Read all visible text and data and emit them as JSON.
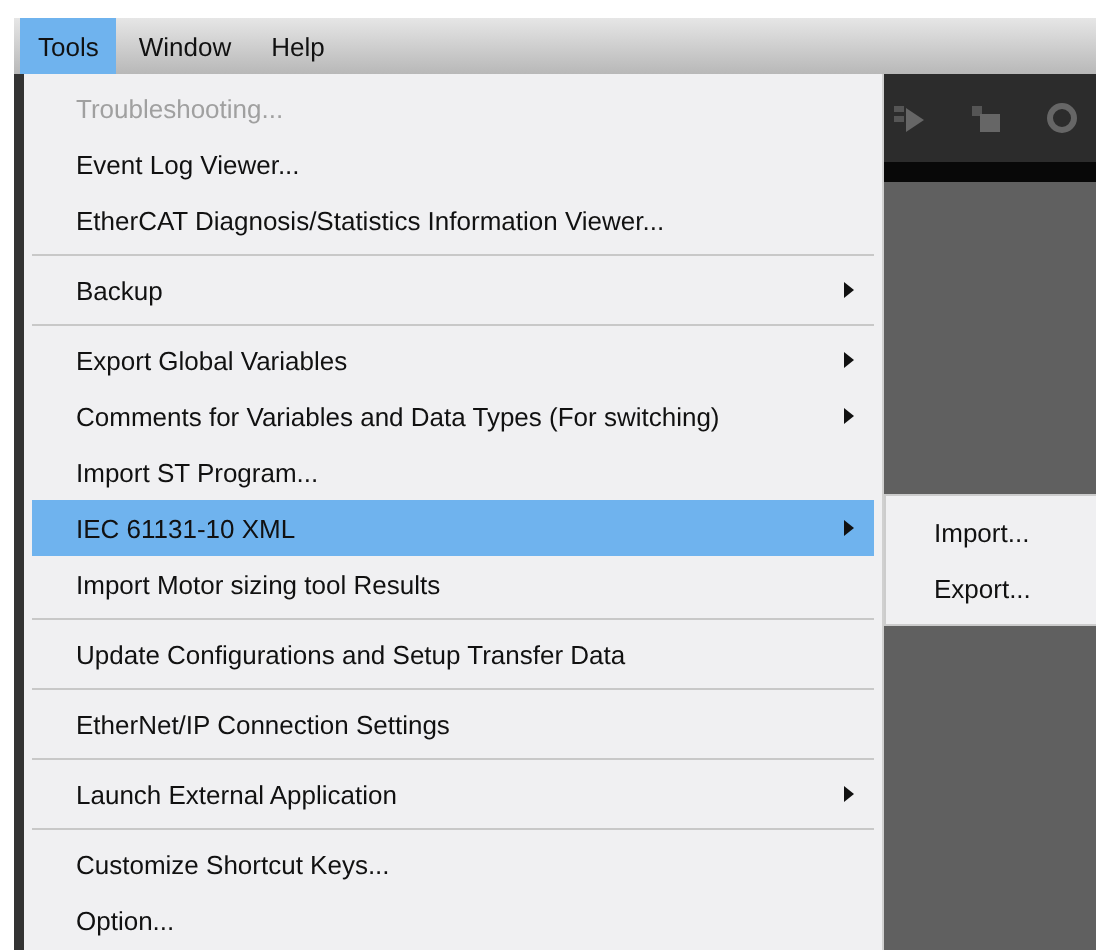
{
  "menubar": [
    {
      "label": "Tools",
      "selected": true
    },
    {
      "label": "Window",
      "selected": false
    },
    {
      "label": "Help",
      "selected": false
    }
  ],
  "menu": [
    {
      "kind": "item",
      "label": "Troubleshooting...",
      "disabled": true,
      "submenu": false,
      "selected": false
    },
    {
      "kind": "item",
      "label": "Event Log Viewer...",
      "disabled": false,
      "submenu": false,
      "selected": false
    },
    {
      "kind": "item",
      "label": "EtherCAT Diagnosis/Statistics Information Viewer...",
      "disabled": false,
      "submenu": false,
      "selected": false
    },
    {
      "kind": "separator"
    },
    {
      "kind": "item",
      "label": "Backup",
      "disabled": false,
      "submenu": true,
      "selected": false
    },
    {
      "kind": "separator"
    },
    {
      "kind": "item",
      "label": "Export Global Variables",
      "disabled": false,
      "submenu": true,
      "selected": false
    },
    {
      "kind": "item",
      "label": "Comments for Variables and Data Types (For switching)",
      "disabled": false,
      "submenu": true,
      "selected": false
    },
    {
      "kind": "item",
      "label": "Import ST Program...",
      "disabled": false,
      "submenu": false,
      "selected": false
    },
    {
      "kind": "item",
      "label": "IEC 61131-10 XML",
      "disabled": false,
      "submenu": true,
      "selected": true
    },
    {
      "kind": "item",
      "label": "Import Motor sizing tool Results",
      "disabled": false,
      "submenu": false,
      "selected": false
    },
    {
      "kind": "separator"
    },
    {
      "kind": "item",
      "label": "Update Configurations and Setup Transfer Data",
      "disabled": false,
      "submenu": false,
      "selected": false
    },
    {
      "kind": "separator"
    },
    {
      "kind": "item",
      "label": "EtherNet/IP Connection Settings",
      "disabled": false,
      "submenu": false,
      "selected": false
    },
    {
      "kind": "separator"
    },
    {
      "kind": "item",
      "label": "Launch External Application",
      "disabled": false,
      "submenu": true,
      "selected": false
    },
    {
      "kind": "separator"
    },
    {
      "kind": "item",
      "label": "Customize Shortcut Keys...",
      "disabled": false,
      "submenu": false,
      "selected": false
    },
    {
      "kind": "item",
      "label": "Option...",
      "disabled": false,
      "submenu": false,
      "selected": false
    }
  ],
  "submenu": [
    {
      "label": "Import...",
      "selected": false
    },
    {
      "label": "Export...",
      "selected": false
    }
  ]
}
